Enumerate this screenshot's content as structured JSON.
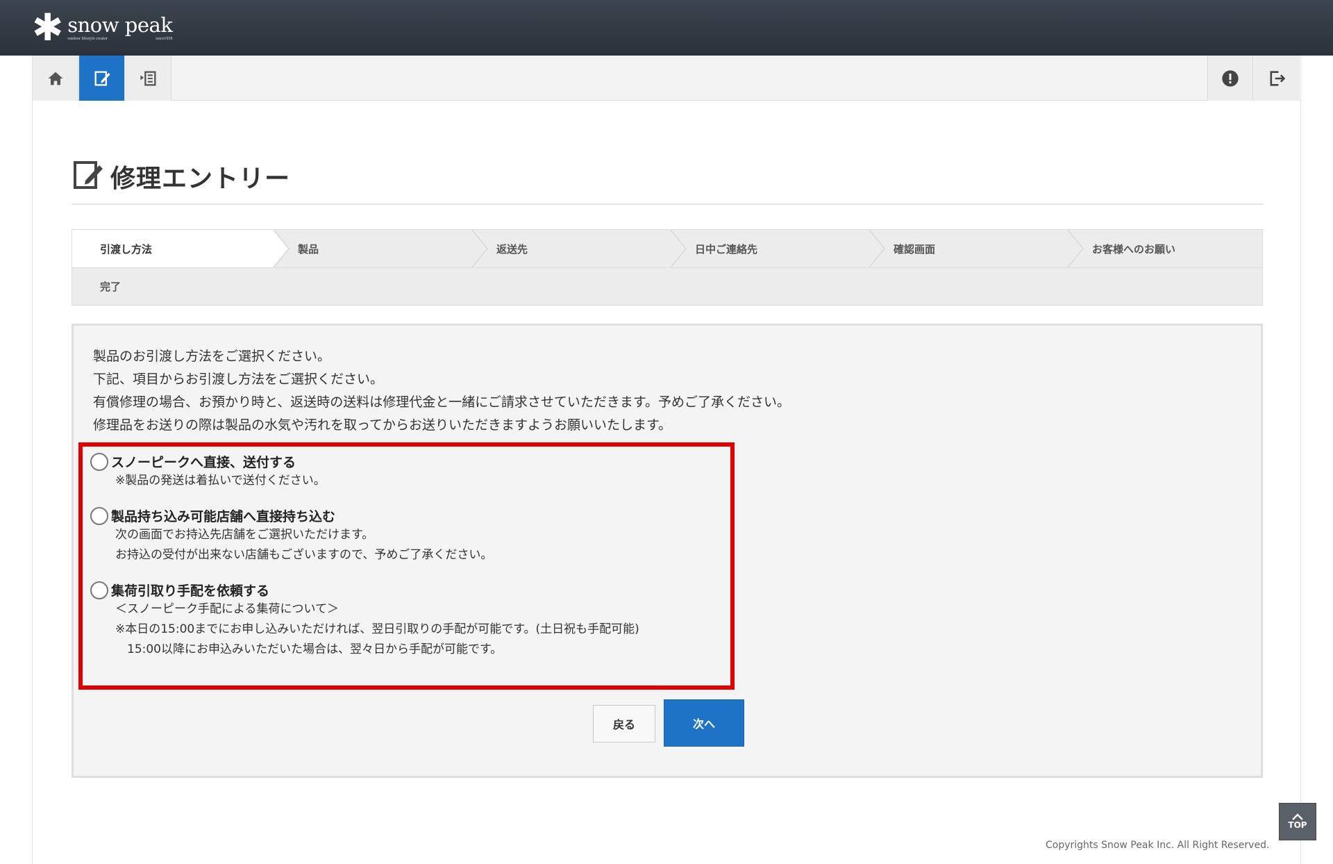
{
  "brand": {
    "name": "snow peak",
    "tagline_left": "outdoor lifestyle creator",
    "tagline_right": "since1958"
  },
  "toolbar": {
    "buttons": [
      {
        "icon": "home-icon"
      },
      {
        "icon": "edit-entry-icon",
        "active": true
      },
      {
        "icon": "history-list-icon"
      },
      {
        "icon": "alert-icon"
      },
      {
        "icon": "logout-icon"
      }
    ]
  },
  "page": {
    "title": "修理エントリー"
  },
  "steps": [
    "引渡し方法",
    "製品",
    "返送先",
    "日中ご連絡先",
    "確認画面",
    "お客様へのお願い",
    "完了"
  ],
  "intro": [
    "製品のお引渡し方法をご選択ください。",
    "下記、項目からお引渡し方法をご選択ください。",
    "有償修理の場合、お預かり時と、返送時の送料は修理代金と一緒にご請求させていただきます。予めご了承ください。",
    "修理品をお送りの際は製品の水気や汚れを取ってからお送りいただきますようお願いいたします。"
  ],
  "options": [
    {
      "label": "スノーピークへ直接、送付する",
      "notes": [
        "※製品の発送は着払いで送付ください。"
      ]
    },
    {
      "label": "製品持ち込み可能店舗へ直接持ち込む",
      "notes": [
        "次の画面でお持込先店舗をご選択いただけます。",
        "お持込の受付が出来ない店舗もございますので、予めご了承ください。"
      ]
    },
    {
      "label": "集荷引取り手配を依頼する",
      "notes": [
        "＜スノーピーク手配による集荷について＞",
        "※本日の15:00までにお申し込みいただければ、翌日引取りの手配が可能です。(土日祝も手配可能)",
        "　15:00以降にお申込みいただいた場合は、翌々日から手配が可能です。"
      ]
    }
  ],
  "buttons": {
    "back": "戻る",
    "next": "次へ"
  },
  "to_top": "TOP",
  "copyright": "Copyrights Snow Peak Inc. All Right Reserved.",
  "colors": {
    "header": "#2f363f",
    "accent": "#1f73c7",
    "highlight": "#e00000"
  }
}
